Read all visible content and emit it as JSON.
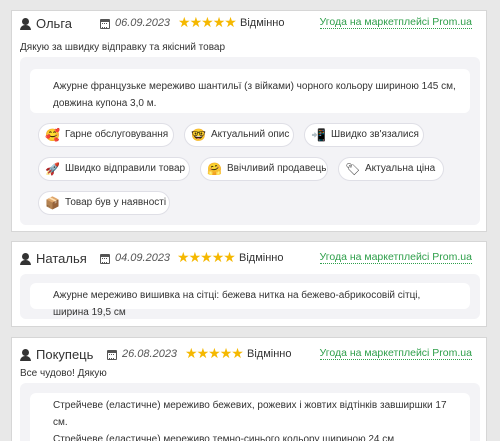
{
  "reviews": [
    {
      "name": "Ольга",
      "date": "06.09.2023",
      "rating_text": "Відмінно",
      "stars": 5,
      "market_link": "Угода на маркетплейсі Prom.ua",
      "comment": "Дякую за швидку відправку та якісний товар",
      "products": [
        "Ажурне французьке мереживо шантильї (з війками) чорного кольору шириною 145 см, довжина купона 3,0 м."
      ],
      "tags": [
        {
          "icon": "smile-hearts-icon",
          "emoji": "🥰",
          "label": "Гарне обслуговування"
        },
        {
          "icon": "nerd-face-icon",
          "emoji": "🤓",
          "label": "Актуальний опис"
        },
        {
          "icon": "phone-icon",
          "emoji": "📲",
          "label": "Швидко зв'язалися"
        },
        {
          "icon": "rocket-icon",
          "emoji": "🚀",
          "label": "Швидко відправили товар"
        },
        {
          "icon": "hugging-face-icon",
          "emoji": "🤗",
          "label": "Ввічливий продавець"
        },
        {
          "icon": "price-tag-icon",
          "emoji": "🏷",
          "label": "Актуальна ціна"
        },
        {
          "icon": "package-icon",
          "emoji": "📦",
          "label": "Товар був у наявності"
        }
      ]
    },
    {
      "name": "Наталья",
      "date": "04.09.2023",
      "rating_text": "Відмінно",
      "stars": 5,
      "market_link": "Угода на маркетплейсі Prom.ua",
      "comment": "",
      "products": [
        "Ажурне мереживо вишивка на сітці: бежева нитка на бежево-абрикосовій сітці, ширина 19,5 см"
      ],
      "tags": []
    },
    {
      "name": "Покупець",
      "date": "26.08.2023",
      "rating_text": "Відмінно",
      "stars": 5,
      "market_link": "Угода на маркетплейсі Prom.ua",
      "comment": "Все чудово! Дякую",
      "products": [
        "Стрейчеве (еластичне) мереживо бежевих, рожевих і жовтих відтінків завширшки 17 см.",
        "Стрейчеве (еластичне) мереживо темно-синього кольору шириною 24 см"
      ],
      "tags": []
    }
  ]
}
